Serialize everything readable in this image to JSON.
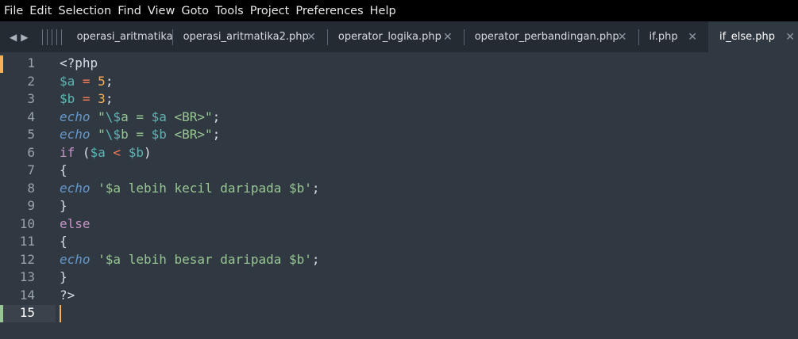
{
  "menu": [
    "File",
    "Edit",
    "Selection",
    "Find",
    "View",
    "Goto",
    "Tools",
    "Project",
    "Preferences",
    "Help"
  ],
  "tabs": [
    {
      "label": "operasi_aritmatika",
      "close": ""
    },
    {
      "label": "operasi_aritmatika2.php",
      "close": "✕"
    },
    {
      "label": "operator_logika.php",
      "close": "✕"
    },
    {
      "label": "operator_perbandingan.php",
      "close": "✕"
    },
    {
      "label": "if.php",
      "close": "✕"
    },
    {
      "label": "if_else.php",
      "close": "✕"
    }
  ],
  "active_tab": "if_else.php",
  "icons": {
    "back": "◀",
    "forward": "▶"
  },
  "colors": {
    "background": "#303841",
    "variable": "#5fb4b4",
    "operator": "#f97b58",
    "number": "#f9ae58",
    "function": "#6699cc",
    "string": "#99c794",
    "keyword": "#c695c6",
    "modified_marker": "#f9ae58",
    "added_marker": "#99c794"
  },
  "line_numbers": [
    "1",
    "2",
    "3",
    "4",
    "5",
    "6",
    "7",
    "8",
    "9",
    "10",
    "11",
    "12",
    "13",
    "14",
    "15"
  ],
  "code": {
    "l1": {
      "a": "<?php"
    },
    "l2": {
      "a": "$a",
      "b": " = ",
      "c": "5",
      "d": ";"
    },
    "l3": {
      "a": "$b",
      "b": " = ",
      "c": "3",
      "d": ";"
    },
    "l4": {
      "a": "echo",
      "b": " \"",
      "c": "\\$",
      "d": "a = ",
      "e": "$a",
      "f": " <BR>\"",
      "g": ";"
    },
    "l5": {
      "a": "echo",
      "b": " \"",
      "c": "\\$",
      "d": "b = ",
      "e": "$b",
      "f": " <BR>\"",
      "g": ";"
    },
    "l6": {
      "a": "if",
      "b": " (",
      "c": "$a",
      "d": " < ",
      "e": "$b",
      "f": ")"
    },
    "l7": {
      "a": "{"
    },
    "l8": {
      "a": "echo",
      "b": " '$a lebih kecil daripada $b'",
      "c": ";"
    },
    "l9": {
      "a": "}"
    },
    "l10": {
      "a": "else"
    },
    "l11": {
      "a": "{"
    },
    "l12": {
      "a": "echo",
      "b": " '$a lebih besar daripada $b'",
      "c": ";"
    },
    "l13": {
      "a": "}"
    },
    "l14": {
      "a": "?>"
    },
    "l15": {
      "a": ""
    }
  }
}
